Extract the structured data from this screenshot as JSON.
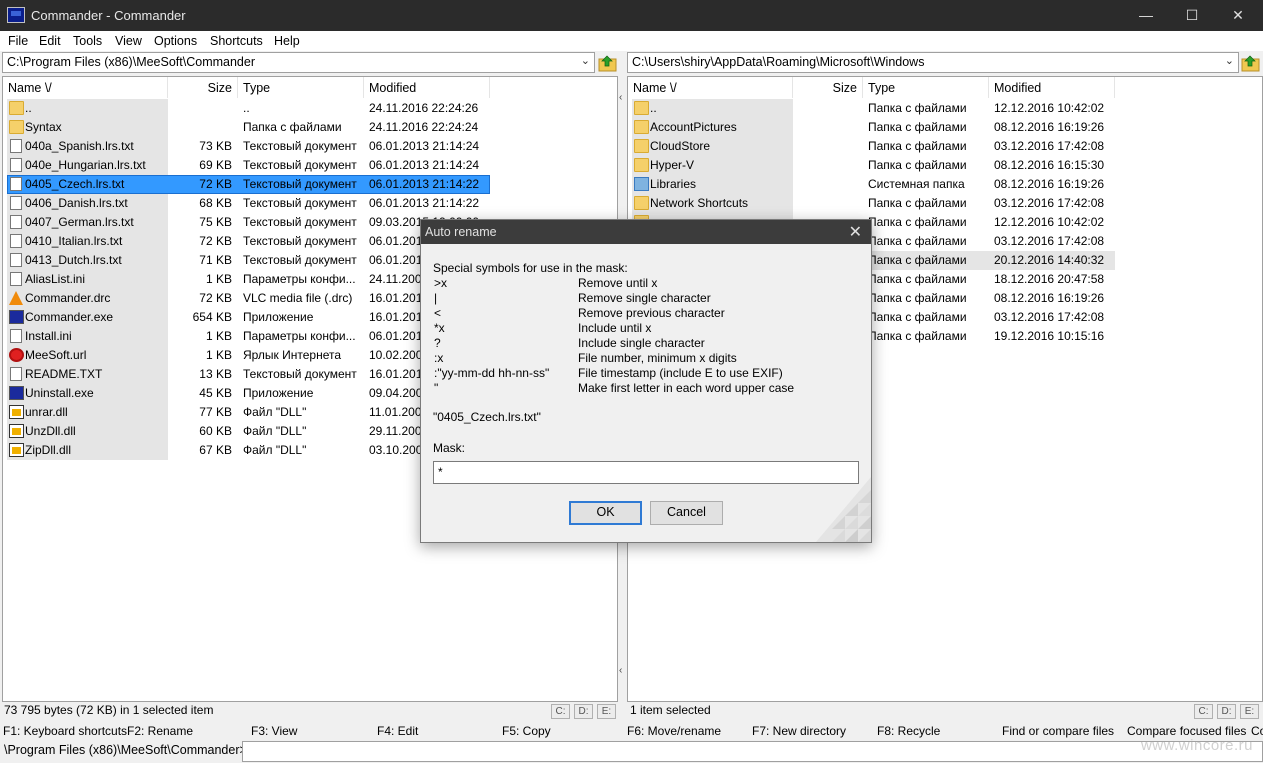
{
  "window": {
    "title": "Commander - Commander",
    "minimize": "—",
    "maximize": "☐",
    "close": "✕"
  },
  "menu": [
    "File",
    "Edit",
    "Tools",
    "View",
    "Options",
    "Shortcuts",
    "Help"
  ],
  "left": {
    "path": "C:\\Program Files (x86)\\MeeSoft\\Commander",
    "headers": {
      "name": "Name \\/",
      "size": "Size",
      "type": "Type",
      "modified": "Modified"
    },
    "rows": [
      {
        "icon": "folder",
        "name": "..",
        "size": "",
        "type": "..",
        "modified": "24.11.2016 22:24:26"
      },
      {
        "icon": "folder",
        "name": "Syntax",
        "size": "",
        "type": "Папка с файлами",
        "modified": "24.11.2016 22:24:24"
      },
      {
        "icon": "doc",
        "name": "040a_Spanish.lrs.txt",
        "size": "73 KB",
        "type": "Текстовый документ",
        "modified": "06.01.2013 21:14:24"
      },
      {
        "icon": "doc",
        "name": "040e_Hungarian.lrs.txt",
        "size": "69 KB",
        "type": "Текстовый документ",
        "modified": "06.01.2013 21:14:24"
      },
      {
        "icon": "doc",
        "name": "0405_Czech.lrs.txt",
        "size": "72 KB",
        "type": "Текстовый документ",
        "modified": "06.01.2013 21:14:22"
      },
      {
        "icon": "doc",
        "name": "0406_Danish.lrs.txt",
        "size": "68 KB",
        "type": "Текстовый документ",
        "modified": "06.01.2013 21:14:22"
      },
      {
        "icon": "doc",
        "name": "0407_German.lrs.txt",
        "size": "75 KB",
        "type": "Текстовый документ",
        "modified": "09.03.2015 19:00:00"
      },
      {
        "icon": "doc",
        "name": "0410_Italian.lrs.txt",
        "size": "72 KB",
        "type": "Текстовый документ",
        "modified": "06.01.2013"
      },
      {
        "icon": "doc",
        "name": "0413_Dutch.lrs.txt",
        "size": "71 KB",
        "type": "Текстовый документ",
        "modified": "06.01.2013"
      },
      {
        "icon": "doc",
        "name": "AliasList.ini",
        "size": "1 KB",
        "type": "Параметры конфи...",
        "modified": "24.11.2007"
      },
      {
        "icon": "vlc",
        "name": "Commander.drc",
        "size": "72 KB",
        "type": "VLC media file (.drc)",
        "modified": "16.01.2016"
      },
      {
        "icon": "exe",
        "name": "Commander.exe",
        "size": "654 KB",
        "type": "Приложение",
        "modified": "16.01.2016"
      },
      {
        "icon": "doc",
        "name": "Install.ini",
        "size": "1 KB",
        "type": "Параметры конфи...",
        "modified": "06.01.2013"
      },
      {
        "icon": "url",
        "name": "MeeSoft.url",
        "size": "1 KB",
        "type": "Ярлык Интернета",
        "modified": "10.02.2004"
      },
      {
        "icon": "doc",
        "name": "README.TXT",
        "size": "13 KB",
        "type": "Текстовый документ",
        "modified": "16.01.2016"
      },
      {
        "icon": "exe",
        "name": "Uninstall.exe",
        "size": "45 KB",
        "type": "Приложение",
        "modified": "09.04.2007"
      },
      {
        "icon": "dll",
        "name": "unrar.dll",
        "size": "77 KB",
        "type": "Файл \"DLL\"",
        "modified": "11.01.2007"
      },
      {
        "icon": "dll",
        "name": "UnzDll.dll",
        "size": "60 KB",
        "type": "Файл \"DLL\"",
        "modified": "29.11.2003"
      },
      {
        "icon": "dll",
        "name": "ZipDll.dll",
        "size": "67 KB",
        "type": "Файл \"DLL\"",
        "modified": "03.10.2003"
      }
    ],
    "status": "73 795 bytes (72 KB) in 1 selected item"
  },
  "right": {
    "path": "C:\\Users\\shiry\\AppData\\Roaming\\Microsoft\\Windows",
    "headers": {
      "name": "Name \\/",
      "size": "Size",
      "type": "Type",
      "modified": "Modified"
    },
    "rows": [
      {
        "icon": "folder",
        "name": "..",
        "size": "",
        "type": "Папка с файлами",
        "modified": "12.12.2016 10:42:02"
      },
      {
        "icon": "folder",
        "name": "AccountPictures",
        "size": "",
        "type": "Папка с файлами",
        "modified": "08.12.2016 16:19:26"
      },
      {
        "icon": "folder",
        "name": "CloudStore",
        "size": "",
        "type": "Папка с файлами",
        "modified": "03.12.2016 17:42:08"
      },
      {
        "icon": "folder",
        "name": "Hyper-V",
        "size": "",
        "type": "Папка с файлами",
        "modified": "08.12.2016 16:15:30"
      },
      {
        "icon": "lib",
        "name": "Libraries",
        "size": "",
        "type": "Системная папка",
        "modified": "08.12.2016 16:19:26"
      },
      {
        "icon": "folder",
        "name": "Network Shortcuts",
        "size": "",
        "type": "Папка с файлами",
        "modified": "03.12.2016 17:42:08"
      },
      {
        "icon": "folder",
        "name": "",
        "size": "",
        "type": "Папка с файлами",
        "modified": "12.12.2016 10:42:02"
      },
      {
        "icon": "folder",
        "name": "",
        "size": "",
        "type": "Папка с файлами",
        "modified": "03.12.2016 17:42:08"
      },
      {
        "icon": "folder",
        "name": "",
        "size": "",
        "type": "Папка с файлами",
        "modified": "20.12.2016 14:40:32"
      },
      {
        "icon": "folder",
        "name": "",
        "size": "",
        "type": "Папка с файлами",
        "modified": "18.12.2016 20:47:58"
      },
      {
        "icon": "folder",
        "name": "",
        "size": "",
        "type": "Папка с файлами",
        "modified": "08.12.2016 16:19:26"
      },
      {
        "icon": "folder",
        "name": "",
        "size": "",
        "type": "Папка с файлами",
        "modified": "03.12.2016 17:42:08"
      },
      {
        "icon": "folder",
        "name": "",
        "size": "",
        "type": "Папка с файлами",
        "modified": "19.12.2016 10:15:16"
      }
    ],
    "status": "1 item selected"
  },
  "drives": [
    "C:",
    "D:",
    "E:"
  ],
  "fkeys": [
    "F1: Keyboard shortcuts",
    "F2: Rename",
    "F3: View",
    "F4: Edit",
    "F5: Copy",
    "F6: Move/rename",
    "F7: New directory",
    "F8: Recycle",
    "Find or compare files",
    "Compare focused files",
    "Co"
  ],
  "cmdline": {
    "prompt": "\\Program Files (x86)\\MeeSoft\\Commander>"
  },
  "watermark": "www.wincore.ru",
  "dialog": {
    "title": "Auto rename",
    "close": "✕",
    "intro": "Special symbols for use in the mask:",
    "symbols": [
      {
        "sym": ">x",
        "desc": "Remove until x"
      },
      {
        "sym": "|",
        "desc": "Remove single character"
      },
      {
        "sym": "<",
        "desc": "Remove previous character"
      },
      {
        "sym": "*x",
        "desc": "Include until x"
      },
      {
        "sym": "?",
        "desc": "Include single character"
      },
      {
        "sym": ":x",
        "desc": "File number, minimum x digits"
      },
      {
        "sym": ":\"yy-mm-dd hh-nn-ss\"",
        "desc": "File timestamp (include E to use EXIF)"
      },
      {
        "sym": "\"",
        "desc": "Make first letter in each word upper case"
      }
    ],
    "example": "\"0405_Czech.lrs.txt\"",
    "mask_label": "Mask:",
    "mask_value": "*",
    "ok": "OK",
    "cancel": "Cancel"
  },
  "colors": {
    "selection": "#3399ff",
    "titlebar": "#2b2b2b",
    "dialog_title": "#3c3c3c"
  }
}
